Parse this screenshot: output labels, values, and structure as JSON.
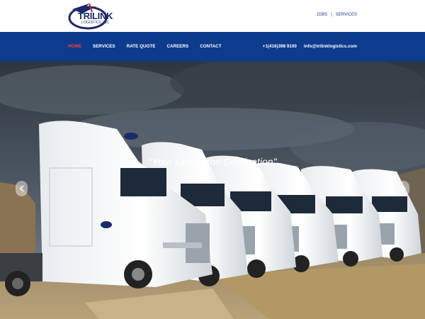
{
  "header": {
    "logo_text": "TRILINK",
    "logo_subtext": "LOGISTICS INC.",
    "top_links": [
      "JOBS",
      "SERVICES"
    ],
    "top_separator": "|"
  },
  "nav": {
    "items": [
      "HOME",
      "SERVICES",
      "RATE QUOTE",
      "CAREERS",
      "CONTACT"
    ],
    "active_index": 0,
    "phone": "+1(416)398 9100",
    "email": "info@trilinklogistics.com"
  },
  "hero": {
    "tagline": "\"Your Link to the Destination\"",
    "prev_icon": "chevron-left-icon",
    "next_icon": "chevron-right-icon"
  },
  "colors": {
    "nav_bg": "#0d3b8e",
    "active_nav": "#ff3b3b",
    "brand": "#1a2a6c"
  }
}
